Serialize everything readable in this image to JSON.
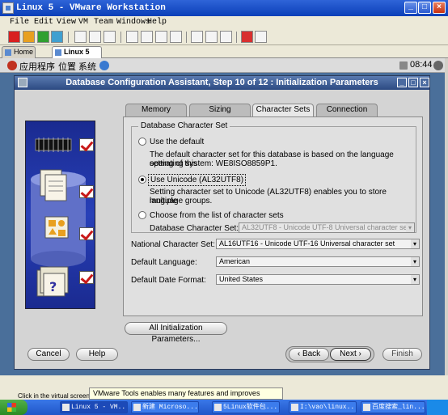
{
  "vmware": {
    "title": "Linux 5 - VMware Workstation",
    "menu": [
      "File",
      "Edit",
      "View",
      "VM",
      "Team",
      "Windows",
      "Help"
    ],
    "tabs": [
      {
        "label": "Home"
      },
      {
        "label": "Linux 5",
        "close": "×"
      }
    ],
    "window_buttons": [
      "_",
      "□",
      "×"
    ]
  },
  "guest_panel": {
    "apps": "应用程序",
    "places": "位置",
    "system": "系统",
    "clock": "08:44"
  },
  "dialog": {
    "title": "Database Configuration Assistant, Step 10 of 12 : Initialization Parameters",
    "tabs": [
      "Memory",
      "Sizing",
      "Character Sets",
      "Connection Mode"
    ],
    "active_tab": "Character Sets",
    "db_charset_legend": "Database Character Set",
    "opt_default": "Use the default",
    "opt_default_desc1": "The default character set for this database is based on the language setting of this",
    "opt_default_desc2": "operating system: WE8ISO8859P1.",
    "opt_unicode": "Use Unicode (AL32UTF8)",
    "opt_unicode_desc1": "Setting character set to Unicode (AL32UTF8) enables you to store multiple",
    "opt_unicode_desc2": "language groups.",
    "opt_list": "Choose from the list of character sets",
    "db_charset_label": "Database Character Set:",
    "db_charset_value": "AL32UTF8 - Unicode UTF-8 Universal character set",
    "national_label": "National Character Set:",
    "national_value": "AL16UTF16 - Unicode UTF-16 Universal character set",
    "language_label": "Default Language:",
    "language_value": "American",
    "date_format_label": "Default Date Format:",
    "date_format_value": "United States",
    "all_params_button": "All Initialization Parameters...",
    "cancel": "Cancel",
    "help": "Help",
    "back": "Back",
    "next": "Next",
    "finish": "Finish"
  },
  "status": {
    "tools_tip": "VMware Tools enables many features and improves mouse",
    "hint": "Click in the virtual screen"
  },
  "taskbar": [
    "Linux 5 - VM...",
    "新建 Microso...",
    "5Linux软件包...",
    "I:\\vao\\linux...",
    "百度搜索_lin..."
  ]
}
